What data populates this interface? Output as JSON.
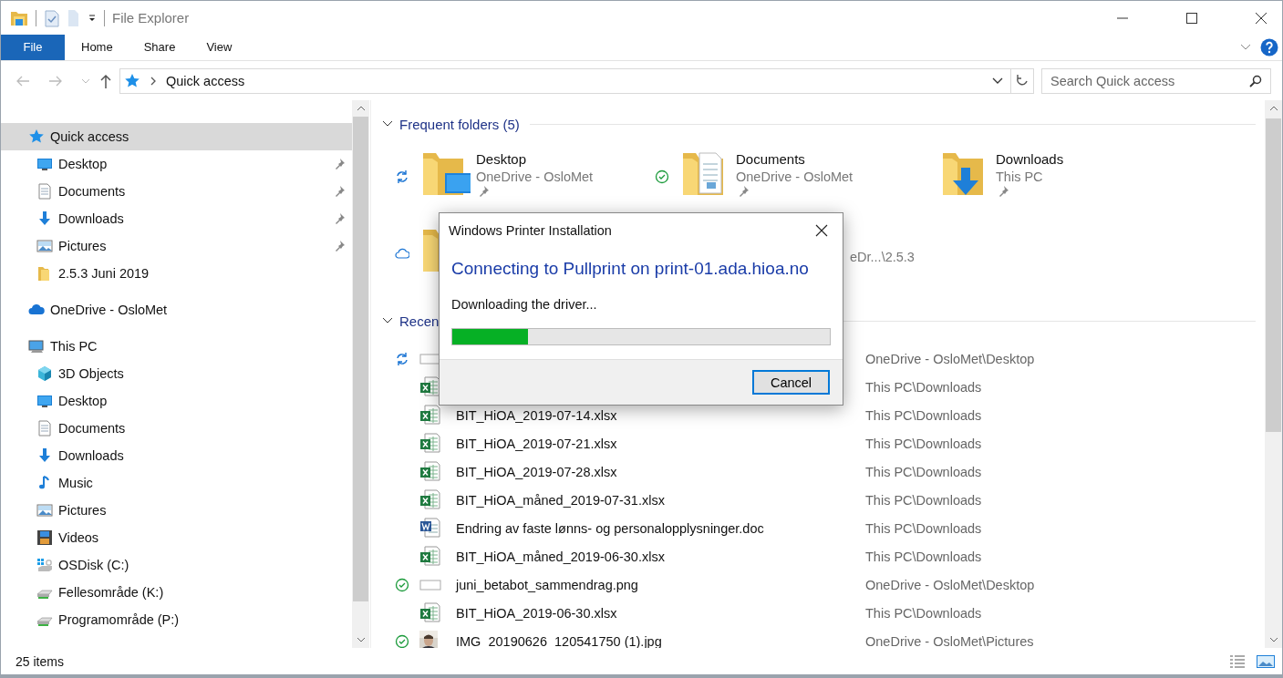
{
  "window": {
    "title": "File Explorer"
  },
  "ribbon": {
    "tabs": [
      {
        "label": "File",
        "kind": "file"
      },
      {
        "label": "Home",
        "kind": "tab"
      },
      {
        "label": "Share",
        "kind": "tab"
      },
      {
        "label": "View",
        "kind": "tab"
      }
    ]
  },
  "address_bar": {
    "path": "Quick access"
  },
  "search": {
    "placeholder": "Search Quick access"
  },
  "sidebar": {
    "items": [
      {
        "label": "Quick access",
        "kind": "star",
        "selected": true,
        "children": [
          {
            "label": "Desktop",
            "kind": "desktop",
            "pinned": true,
            "selected": false
          },
          {
            "label": "Documents",
            "kind": "documents",
            "pinned": true,
            "selected": false
          },
          {
            "label": "Downloads",
            "kind": "downloads",
            "pinned": true,
            "selected": false
          },
          {
            "label": "Pictures",
            "kind": "pictures",
            "pinned": true,
            "selected": false
          },
          {
            "label": "2.5.3 Juni 2019",
            "kind": "folder",
            "pinned": false,
            "selected": false
          }
        ]
      },
      {
        "label": "OneDrive - OsloMet",
        "kind": "onedrive",
        "selected": false
      },
      {
        "label": "This PC",
        "kind": "pc",
        "selected": false,
        "children": [
          {
            "label": "3D Objects",
            "kind": "objects3d",
            "selected": false
          },
          {
            "label": "Desktop",
            "kind": "desktop",
            "selected": false
          },
          {
            "label": "Documents",
            "kind": "documents",
            "selected": false
          },
          {
            "label": "Downloads",
            "kind": "downloads",
            "selected": false
          },
          {
            "label": "Music",
            "kind": "music",
            "selected": false
          },
          {
            "label": "Pictures",
            "kind": "pictures",
            "selected": false
          },
          {
            "label": "Videos",
            "kind": "videos",
            "selected": false
          },
          {
            "label": "OSDisk (C:)",
            "kind": "osdisk",
            "selected": false
          },
          {
            "label": "Fellesområde (K:)",
            "kind": "netdrive",
            "selected": false
          },
          {
            "label": "Programområde (P:)",
            "kind": "netdrive",
            "selected": false
          }
        ]
      }
    ]
  },
  "frequent_folders": {
    "title": "Frequent folders (5)",
    "items": [
      {
        "name": "Desktop",
        "location": "OneDrive - OsloMet",
        "kind": "desktop",
        "syncing": true,
        "synced": false,
        "online_only": false,
        "pinned": true
      },
      {
        "name": "Documents",
        "location": "OneDrive - OsloMet",
        "kind": "documents",
        "syncing": false,
        "synced": true,
        "online_only": false,
        "pinned": true
      },
      {
        "name": "Downloads",
        "location": "This PC",
        "kind": "downloads",
        "syncing": false,
        "synced": false,
        "online_only": false,
        "pinned": true
      },
      {
        "location": "eDr...\\2.5.3",
        "kind": "folder",
        "syncing": false,
        "synced": false,
        "online_only": true,
        "pinned": false
      }
    ]
  },
  "recent_files": {
    "title": "Recen",
    "items": [
      {
        "location": "OneDrive - OsloMet\\Desktop",
        "kind": "blank",
        "syncing": true,
        "synced": false
      },
      {
        "location": "This PC\\Downloads",
        "kind": "excel",
        "syncing": false,
        "synced": false
      },
      {
        "name": "BIT_HiOA_2019-07-14.xlsx",
        "location": "This PC\\Downloads",
        "kind": "excel",
        "syncing": false,
        "synced": false
      },
      {
        "name": "BIT_HiOA_2019-07-21.xlsx",
        "location": "This PC\\Downloads",
        "kind": "excel",
        "syncing": false,
        "synced": false
      },
      {
        "name": "BIT_HiOA_2019-07-28.xlsx",
        "location": "This PC\\Downloads",
        "kind": "excel",
        "syncing": false,
        "synced": false
      },
      {
        "name": "BIT_HiOA_måned_2019-07-31.xlsx",
        "location": "This PC\\Downloads",
        "kind": "excel",
        "syncing": false,
        "synced": false
      },
      {
        "name": "Endring av faste lønns- og personalopplysninger.doc",
        "location": "This PC\\Downloads",
        "kind": "word",
        "syncing": false,
        "synced": false
      },
      {
        "name": "BIT_HiOA_måned_2019-06-30.xlsx",
        "location": "This PC\\Downloads",
        "kind": "excel",
        "syncing": false,
        "synced": false
      },
      {
        "name": "juni_betabot_sammendrag.png",
        "location": "OneDrive - OsloMet\\Desktop",
        "kind": "blank",
        "syncing": false,
        "synced": true
      },
      {
        "name": "BIT_HiOA_2019-06-30.xlsx",
        "location": "This PC\\Downloads",
        "kind": "excel",
        "syncing": false,
        "synced": false
      },
      {
        "name": "IMG_20190626_120541750 (1).jpg",
        "location": "OneDrive - OsloMet\\Pictures",
        "syncing": false,
        "synced": true
      }
    ]
  },
  "status_bar": {
    "count": "25 items"
  },
  "dialog": {
    "title": "Windows Printer Installation",
    "heading": "Connecting to Pullprint on print-01.ada.hioa.no",
    "message": "Downloading the driver...",
    "progress": {
      "level": 0.2
    },
    "buttons": [
      "Cancel"
    ]
  }
}
